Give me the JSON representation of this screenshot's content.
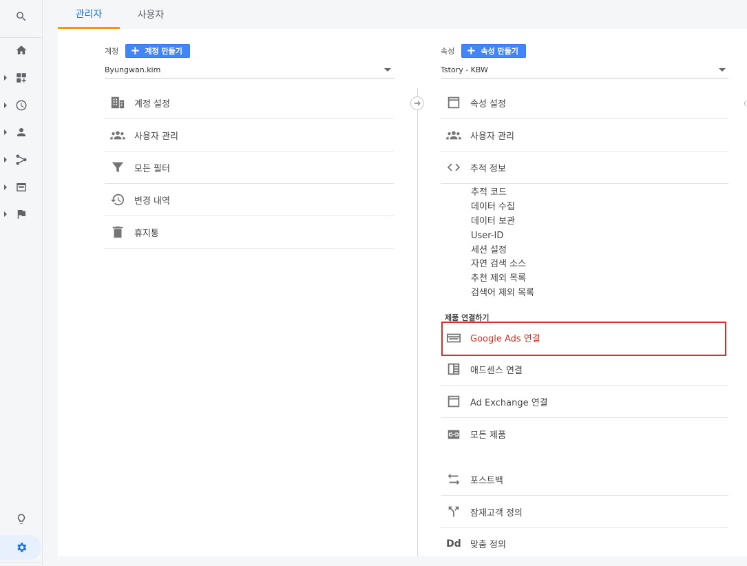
{
  "tabs": [
    {
      "label": "관리자",
      "active": true
    },
    {
      "label": "사용자",
      "active": false
    }
  ],
  "rail": {
    "items": [
      "search-icon",
      "home-icon",
      "dashboard-add-icon",
      "clock-icon",
      "person-icon",
      "acquisition-icon",
      "behavior-icon",
      "flag-icon",
      "lightbulb-icon",
      "gear-icon"
    ],
    "active_color": "#1a73e8"
  },
  "account": {
    "label": "계정",
    "create_label": "계정 만들기",
    "selected": "Byungwan.kim",
    "menu": [
      {
        "label": "계정 설정",
        "icon": "building-icon"
      },
      {
        "label": "사용자 관리",
        "icon": "people-icon"
      },
      {
        "label": "모든 필터",
        "icon": "filter-icon"
      },
      {
        "label": "변경 내역",
        "icon": "history-icon"
      },
      {
        "label": "휴지통",
        "icon": "trash-icon"
      }
    ]
  },
  "property": {
    "label": "속성",
    "create_label": "속성 만들기",
    "selected": "Tstory - KBW",
    "menu_top": [
      {
        "label": "속성 설정",
        "icon": "window-icon"
      },
      {
        "label": "사용자 관리",
        "icon": "people-icon"
      },
      {
        "label": "추적 정보",
        "icon": "code-icon"
      }
    ],
    "tracking_sub": [
      "추적 코드",
      "데이터 수집",
      "데이터 보관",
      "User-ID",
      "세션 설정",
      "자연 검색 소스",
      "추천 제외 목록",
      "검색어 제외 목록"
    ],
    "product_section_label": "제품 연결하기",
    "product_links": [
      {
        "label": "Google Ads 연결",
        "icon": "ads-icon",
        "highlighted": true
      },
      {
        "label": "애드센스 연결",
        "icon": "adsense-icon"
      },
      {
        "label": "Ad Exchange 연결",
        "icon": "window-icon"
      },
      {
        "label": "모든 제품",
        "icon": "link-box-icon"
      }
    ],
    "menu_bottom": [
      {
        "label": "포스트백",
        "icon": "swap-icon"
      },
      {
        "label": "잠재고객 정의",
        "icon": "fork-icon"
      },
      {
        "label": "맞춤 정의",
        "icon": "dd-icon"
      }
    ],
    "dd_glyph": "Dd"
  },
  "colors": {
    "accent": "#1a73e8",
    "tab_underline": "#f29900",
    "button": "#4285f4",
    "highlight": "#d93025"
  }
}
